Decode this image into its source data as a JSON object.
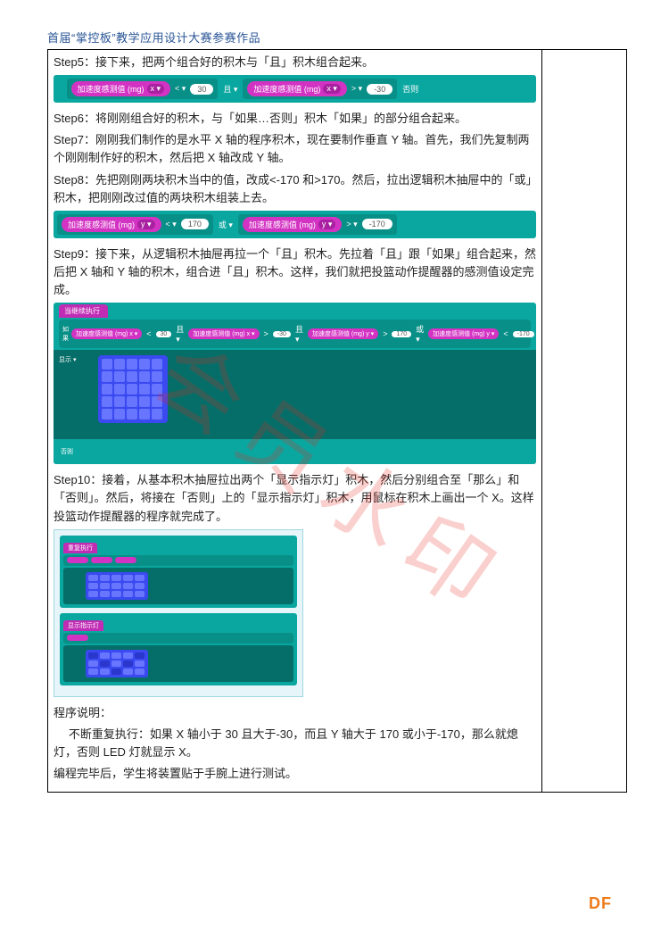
{
  "header": "首届“掌控板”教学应用设计大赛参赛作品",
  "watermark": "会员水印",
  "footer": "DF",
  "steps": {
    "s5": "Step5：接下来，把两个组合好的积木与「且」积木组合起来。",
    "s6": "Step6：将刚刚组合好的积木，与「如果…否则」积木「如果」的部分组合起来。",
    "s7": "Step7：刚刚我们制作的是水平 X 轴的程序积木，现在要制作垂直 Y 轴。首先，我们先复制两个刚刚制作好的积木，然后把 X 轴改成 Y 轴。",
    "s8": "Step8：先把刚刚两块积木当中的值，改成<-170 和>170。然后，拉出逻辑积木抽屉中的「或」积木，把刚刚改过值的两块积木组装上去。",
    "s9": "Step9：接下来，从逻辑积木抽屉再拉一个「且」积木。先拉着「且」跟「如果」组合起来，然后把 X 轴和 Y 轴的积木，组合进「且」积木。这样，我们就把投篮动作提醒器的感测值设定完成。",
    "s10": "Step10：接着，从基本积木抽屉拉出两个「显示指示灯」积木，然后分别组合至「那么」和「否则」。然后，将接在「否则」上的「显示指示灯」积木，用鼠标在积木上画出一个 X。这样投篮动作提醒器的程序就完成了。"
  },
  "explain": {
    "title": "程序说明：",
    "body": "不断重复执行：如果 X 轴小于 30 且大于-30，而且 Y 轴大于 170 或小于-170，那么就熄灯，否则 LED 灯就显示 X。",
    "end": "编程完毕后，学生将装置贴于手腕上进行测试。"
  },
  "block1": {
    "sensor": "加速度感测值 (mg)",
    "axis_x": "x ▾",
    "op_lt": "< ▾",
    "op_gt": "> ▾",
    "v30": "30",
    "vneg30": "-30",
    "and": "且 ▾",
    "else": "否则"
  },
  "block2": {
    "sensor": "加速度感测值 (mg)",
    "axis_y": "y ▾",
    "op_lt": "< ▾",
    "op_gt": "> ▾",
    "v170": "170",
    "vneg170": "-170",
    "or": "或 ▾"
  },
  "block3": {
    "loop": "当继续执行",
    "if": "如果",
    "sensor": "加速度感测值 (mg) x ▾",
    "sensor_y": "加速度感测值 (mg) y ▾",
    "v30": "30",
    "vneg30": "-30",
    "v170": "170",
    "vneg170": "-170",
    "and": "且 ▾",
    "or": "或 ▾",
    "then": "显示 ▾",
    "else": "否则"
  },
  "block4": {
    "loop": "重复执行",
    "disp": "显示指示灯"
  }
}
